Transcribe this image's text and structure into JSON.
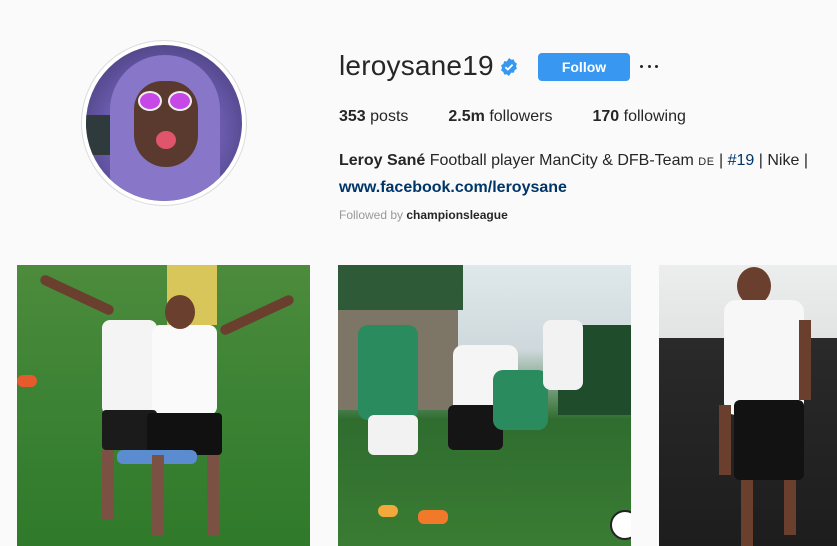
{
  "profile": {
    "username": "leroysane19",
    "verified": true,
    "follow_label": "Follow",
    "more_icon": "ellipsis-icon",
    "stats": [
      {
        "count": "353",
        "label": "posts"
      },
      {
        "count": "2.5m",
        "label": "followers"
      },
      {
        "count": "170",
        "label": "following"
      }
    ],
    "bio": {
      "name": "Leroy Sané",
      "text": "Football player ManCity & DFB-Team",
      "flag": "DE",
      "sep1": "|",
      "hashtag": "#19",
      "sep2": "|",
      "brand": "Nike",
      "sep3": "|",
      "link": "www.facebook.com/leroysane"
    },
    "followed_by_prefix": "Followed by",
    "followed_by_user": "championsleague"
  },
  "colors": {
    "follow_button": "#3897f0",
    "link": "#003569",
    "verified_badge": "#3897f0"
  },
  "posts": [
    {
      "alt": "training-photo"
    },
    {
      "alt": "match-photo"
    },
    {
      "alt": "portrait-photo"
    }
  ]
}
